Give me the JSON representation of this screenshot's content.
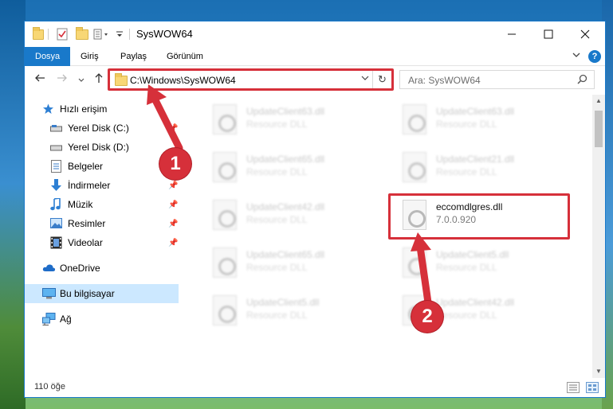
{
  "window": {
    "title": "SysWOW64"
  },
  "ribbon": {
    "tabs": [
      "Dosya",
      "Giriş",
      "Paylaş",
      "Görünüm"
    ]
  },
  "address": {
    "path": "C:\\Windows\\SysWOW64",
    "search_placeholder": "Ara: SysWOW64"
  },
  "sidebar": {
    "items": [
      {
        "label": "Hızlı erişim",
        "icon": "star-icon"
      },
      {
        "label": "Yerel Disk (C:)",
        "icon": "drive-icon"
      },
      {
        "label": "Yerel Disk (D:)",
        "icon": "drive-icon"
      },
      {
        "label": "Belgeler",
        "icon": "document-icon"
      },
      {
        "label": "İndirmeler",
        "icon": "download-arrow-icon"
      },
      {
        "label": "Müzik",
        "icon": "music-note-icon"
      },
      {
        "label": "Resimler",
        "icon": "picture-icon"
      },
      {
        "label": "Videolar",
        "icon": "film-icon"
      },
      {
        "label": "OneDrive",
        "icon": "cloud-icon"
      },
      {
        "label": "Bu bilgisayar",
        "icon": "computer-icon"
      },
      {
        "label": "Ağ",
        "icon": "network-icon"
      }
    ]
  },
  "files": [
    {
      "name": "UpdateClient63.dll",
      "desc": "Resource DLL"
    },
    {
      "name": "UpdateClient63.dll",
      "desc": "Resource DLL"
    },
    {
      "name": "UpdateClient65.dll",
      "desc": "Resource DLL"
    },
    {
      "name": "UpdateClient21.dll",
      "desc": "Resource DLL"
    },
    {
      "name": "UpdateClient42.dll",
      "desc": "Resource DLL"
    },
    {
      "name": "eccomdlgres.dll",
      "desc": "7.0.0.920"
    },
    {
      "name": "UpdateClient65.dll",
      "desc": "Resource DLL"
    },
    {
      "name": "UpdateClient5.dll",
      "desc": "Resource DLL"
    },
    {
      "name": "UpdateClient5.dll",
      "desc": "Resource DLL"
    },
    {
      "name": "UpdateClient42.dll",
      "desc": "Resource DLL"
    }
  ],
  "status": {
    "count": "110 öğe"
  },
  "callouts": [
    "1",
    "2"
  ],
  "colors": {
    "accent": "#1979ca",
    "highlight": "#d6303a",
    "selected_bg": "#cce8ff"
  }
}
